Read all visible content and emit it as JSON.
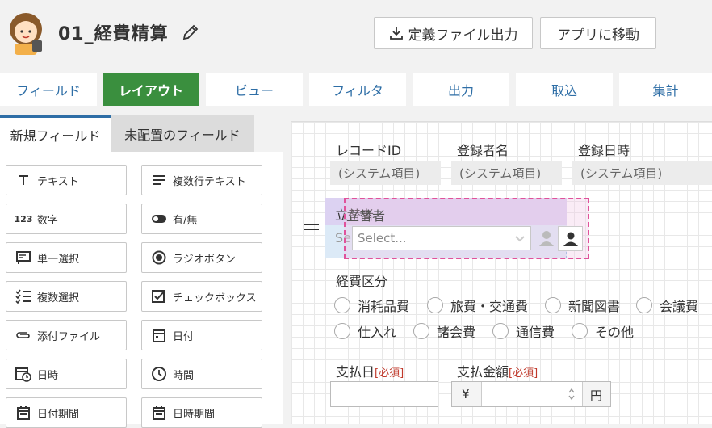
{
  "header": {
    "app_name": "01_経費精算",
    "export_button": "定義ファイル出力",
    "move_to_app_button": "アプリに移動"
  },
  "tabs": [
    {
      "label": "フィールド",
      "active": false
    },
    {
      "label": "レイアウト",
      "active": true
    },
    {
      "label": "ビュー",
      "active": false
    },
    {
      "label": "フィルタ",
      "active": false
    },
    {
      "label": "出力",
      "active": false
    },
    {
      "label": "取込",
      "active": false
    },
    {
      "label": "集計",
      "active": false
    }
  ],
  "subtabs": {
    "new_fields": "新規フィールド",
    "unplaced_fields": "未配置のフィールド"
  },
  "palette": [
    {
      "icon": "text-icon",
      "label": "テキスト"
    },
    {
      "icon": "multiline-text-icon",
      "label": "複数行テキスト"
    },
    {
      "icon": "number-icon",
      "icon_text": "123",
      "label": "数字"
    },
    {
      "icon": "toggle-icon",
      "label": "有/無"
    },
    {
      "icon": "single-select-icon",
      "label": "単一選択"
    },
    {
      "icon": "radio-icon",
      "label": "ラジオボタン"
    },
    {
      "icon": "multi-select-icon",
      "label": "複数選択"
    },
    {
      "icon": "checkbox-icon",
      "label": "チェックボックス"
    },
    {
      "icon": "attachment-icon",
      "label": "添付ファイル"
    },
    {
      "icon": "date-icon",
      "label": "日付"
    },
    {
      "icon": "datetime-icon",
      "label": "日時"
    },
    {
      "icon": "clock-icon",
      "label": "時間"
    },
    {
      "icon": "date-range-icon",
      "label": "日付期間"
    },
    {
      "icon": "datetime-range-icon",
      "label": "日時期間"
    }
  ],
  "form": {
    "record_id_label": "レコードID",
    "registrant_label": "登録者名",
    "registered_at_label": "登録日時",
    "system_placeholder": "(システム項目)",
    "drag_field_label": "立替者",
    "drop_target_label": "立替者",
    "drag_field_value": "Se",
    "user_select_placeholder": "Select...",
    "expense_category_label": "経費区分",
    "expense_options": [
      "消耗品費",
      "旅費・交通費",
      "新聞図書",
      "会議費",
      "仕入れ",
      "諸会費",
      "通信費",
      "その他"
    ],
    "payment_date_label": "支払日",
    "payment_amount_label": "支払金額",
    "required_mark": "[必須]",
    "yen_prefix": "¥",
    "yen_suffix": "円"
  },
  "colors": {
    "accent_green": "#3a8f3e",
    "link_blue": "#2e6ea6",
    "drag_purple": "#d9cdf3",
    "drop_pink": "#e0529b"
  }
}
